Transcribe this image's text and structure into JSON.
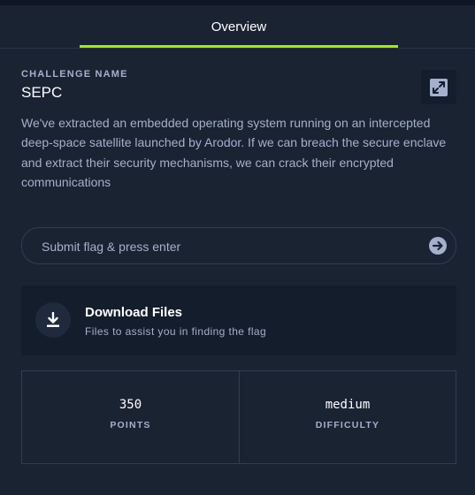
{
  "tabs": [
    {
      "label": "Overview",
      "active": true
    }
  ],
  "challenge": {
    "name_label": "CHALLENGE NAME",
    "name": "SEPC",
    "description": "We've extracted an embedded operating system running on an intercepted deep-space satellite launched by Arodor. If we can breach the secure enclave and extract their security mechanisms, we can crack their encrypted communications"
  },
  "icons": {
    "share": "share-icon",
    "submit": "arrow-right-circle-icon",
    "download": "download-icon"
  },
  "flag": {
    "placeholder": "Submit flag & press enter",
    "value": ""
  },
  "download": {
    "title": "Download Files",
    "subtitle": "Files to assist you in finding the flag"
  },
  "stats": {
    "points_value": "350",
    "points_label": "POINTS",
    "difficulty_value": "medium",
    "difficulty_label": "DIFFICULTY"
  },
  "colors": {
    "background": "#1a2332",
    "panel": "#141d2b",
    "accent": "#9fef00",
    "muted_text": "#a4b1cd",
    "border": "#313d52"
  }
}
